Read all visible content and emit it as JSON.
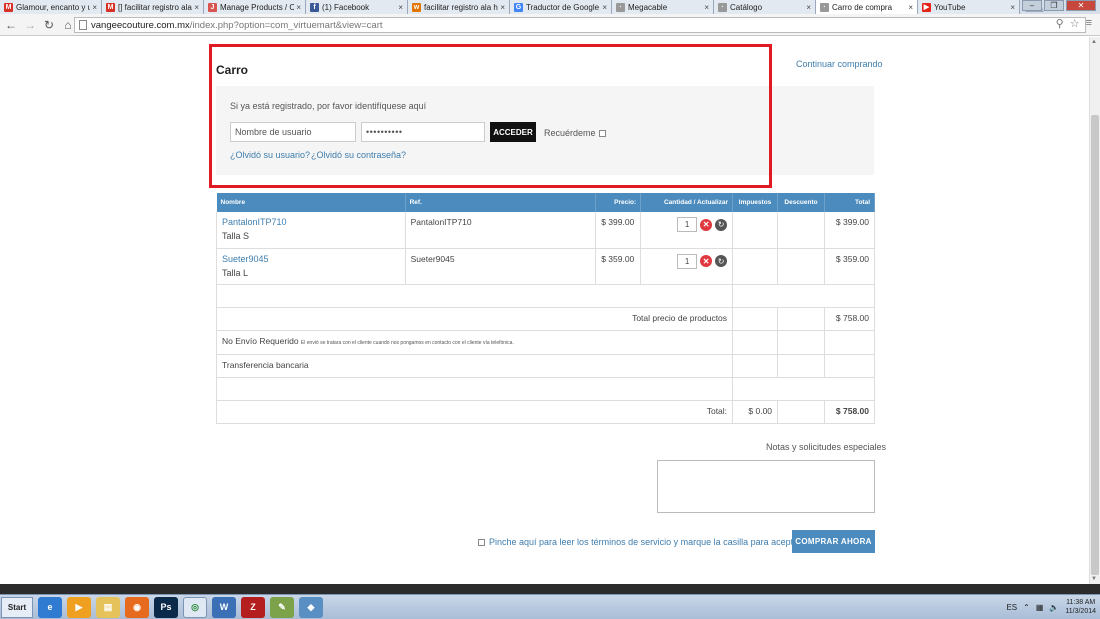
{
  "browser": {
    "tabs": [
      {
        "label": "Glamour, encanto y un",
        "icon": "gmail-icon",
        "color": "#d93025",
        "glyph": "M",
        "active": false
      },
      {
        "label": "[] facilitar registro ala h",
        "icon": "gmail-icon",
        "color": "#d93025",
        "glyph": "M",
        "active": false
      },
      {
        "label": "Manage Products / Ca",
        "icon": "joomla-icon",
        "color": "#d9534f",
        "glyph": "J",
        "active": false
      },
      {
        "label": "(1) Facebook",
        "icon": "facebook-icon",
        "color": "#3b5998",
        "glyph": "f",
        "active": false
      },
      {
        "label": "facilitar registro ala hac",
        "icon": "page-icon",
        "color": "#e37400",
        "glyph": "w",
        "active": false
      },
      {
        "label": "Traductor de Google",
        "icon": "translate-icon",
        "color": "#4285f4",
        "glyph": "G",
        "active": false
      },
      {
        "label": "Megacable",
        "icon": "loading-icon",
        "color": "#999999",
        "glyph": "·",
        "active": false
      },
      {
        "label": "Catálogo",
        "icon": "loading-icon",
        "color": "#999999",
        "glyph": "·",
        "active": false
      },
      {
        "label": "Carro de compra",
        "icon": "loading-icon",
        "color": "#999999",
        "glyph": "·",
        "active": true
      },
      {
        "label": "YouTube",
        "icon": "youtube-icon",
        "color": "#e62117",
        "glyph": "▶",
        "active": false
      }
    ],
    "url_host": "vangeecouture.com.mx",
    "url_path": "/index.php?option=com_virtuemart&view=cart"
  },
  "page": {
    "title": "Carro",
    "continue_link": "Continuar comprando",
    "login": {
      "hint": "Si ya está registrado, por favor identifíquese aquí",
      "username_placeholder": "Nombre de usuario",
      "password_mask": "••••••••••",
      "submit_label": "ACCEDER",
      "remember_label": "Recuérdeme",
      "forgot_user": "¿Olvidó su usuario?",
      "forgot_pass": "¿Olvidó su contraseña?"
    },
    "cart": {
      "headers": [
        "Nombre",
        "Ref.",
        "Precio:",
        "Cantidad / Actualizar",
        "Impuestos",
        "Descuento",
        "Total"
      ],
      "items": [
        {
          "name": "PantalonITP710",
          "variant": "Talla S",
          "ref": "PantalonITP710",
          "price": "$ 399.00",
          "qty": "1",
          "total": "$ 399.00"
        },
        {
          "name": "Sueter9045",
          "variant": "Talla L",
          "ref": "Sueter9045",
          "price": "$ 359.00",
          "qty": "1",
          "total": "$ 359.00"
        }
      ],
      "products_total_label": "Total precio de productos",
      "products_total": "$ 758.00",
      "shipping_label": "No Envío Requerido",
      "shipping_note": "El envió se tratara con el cliente cuando nos pongamos en contacto con el cliente vía telefónica.",
      "payment_label": "Transferencia bancaria",
      "grand_total_label": "Total:",
      "grand_total_tax": "$ 0.00",
      "grand_total": "$ 758.00"
    },
    "notes_label": "Notas y solicitudes especiales",
    "tos_label": "Pinche aquí para leer los términos de servicio y marque la casilla para aceptarlos.",
    "buy_button": "COMPRAR AHORA"
  },
  "taskbar": {
    "start_label": "Start",
    "lang": "ES",
    "time": "11:38 AM",
    "date": "11/3/2014"
  }
}
